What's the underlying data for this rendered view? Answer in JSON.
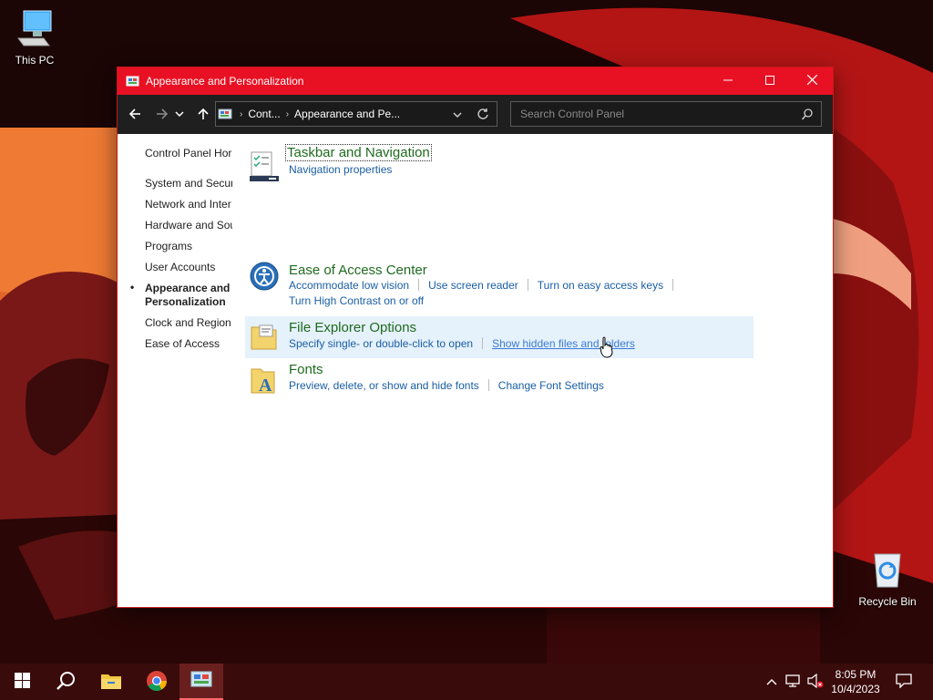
{
  "desktop": {
    "icons": [
      {
        "label": "This PC",
        "icon": "computer-icon"
      },
      {
        "label": "Recycle Bin",
        "icon": "recycle-bin-icon"
      }
    ]
  },
  "window": {
    "title": "Appearance and Personalization",
    "controls": {
      "minimize": "minimize-icon",
      "maximize": "maximize-icon",
      "close": "close-icon"
    }
  },
  "nav": {
    "breadcrumb": [
      "Cont...",
      "Appearance and Pe..."
    ],
    "search_placeholder": "Search Control Panel"
  },
  "sidebar": {
    "home": "Control Panel Hor",
    "items": [
      {
        "label": "System and Securi"
      },
      {
        "label": "Network and Inter"
      },
      {
        "label": "Hardware and Sou"
      },
      {
        "label": "Programs"
      },
      {
        "label": "User Accounts"
      },
      {
        "label": "Appearance and Personalization",
        "current": true
      },
      {
        "label": "Clock and Region"
      },
      {
        "label": "Ease of Access"
      }
    ]
  },
  "categories": [
    {
      "title": "Taskbar and Navigation",
      "icon": "taskbar-icon",
      "links": [
        "Navigation properties"
      ]
    },
    {
      "title": "Ease of Access Center",
      "icon": "ease-of-access-icon",
      "links": [
        "Accommodate low vision",
        "Use screen reader",
        "Turn on easy access keys",
        "Turn High Contrast on or off"
      ]
    },
    {
      "title": "File Explorer Options",
      "icon": "folder-options-icon",
      "links": [
        "Specify single- or double-click to open",
        "Show hidden files and folders"
      ]
    },
    {
      "title": "Fonts",
      "icon": "fonts-icon",
      "links": [
        "Preview, delete, or show and hide fonts",
        "Change Font Settings"
      ]
    }
  ],
  "taskbar": {
    "apps": [
      "start-icon",
      "search-icon",
      "file-explorer-icon",
      "chrome-icon",
      "control-panel-icon"
    ],
    "time": "8:05 PM",
    "date": "10/4/2023"
  },
  "colors": {
    "titlebar": "#e81123",
    "link": "#1a5ea5",
    "heading": "#1e6b1e",
    "highlight": "#e5f1fb"
  }
}
